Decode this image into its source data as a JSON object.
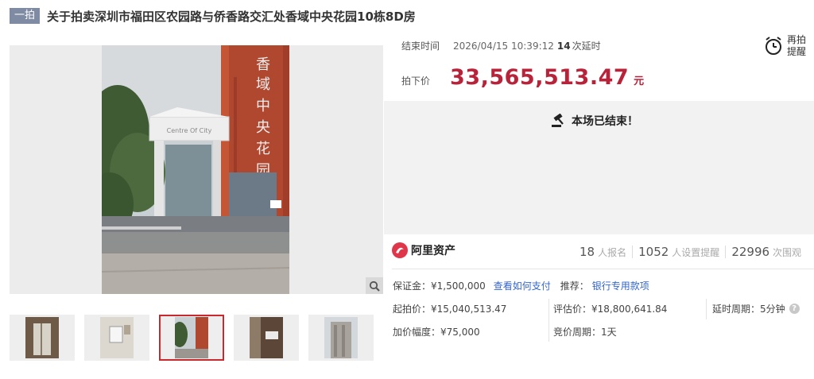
{
  "header": {
    "badge": "一拍",
    "title": "关于拍卖深圳市福田区农园路与侨香路交汇处香域中央花园10栋8D房"
  },
  "auction": {
    "end_time_label": "结束时间",
    "end_time": "2026/04/15 10:39:12",
    "extension_count": "14",
    "extension_label": "次延时",
    "remind_label": "再拍提醒",
    "price_label": "拍下价",
    "price": "33,565,513.47",
    "price_unit": "元",
    "ended_message": "本场已结束！"
  },
  "photo": {
    "building_text": "香域中央花园",
    "sign_text": "Centre Of City"
  },
  "stats": {
    "brand": "阿里资产",
    "registrations": "18",
    "registrations_label": "人报名",
    "reminders": "1052",
    "reminders_label": "人设置提醒",
    "views": "22996",
    "views_label": "次围观"
  },
  "details": {
    "deposit_label": "保证金：",
    "deposit": "¥1,500,000",
    "how_to_pay": "查看如何支付",
    "recommend_label": "推荐：",
    "bank_loan": "银行专用款项",
    "start_price_label": "起拍价：",
    "start_price": "¥15,040,513.47",
    "appraisal_label": "评估价：",
    "appraisal": "¥18,800,641.84",
    "delay_label": "延时周期：",
    "delay": "5分钟",
    "increment_label": "加价幅度：",
    "increment": "¥75,000",
    "bid_cycle_label": "竞价周期：",
    "bid_cycle": "1天"
  },
  "colors": {
    "price": "#b8233a",
    "link": "#3366cc",
    "badge": "#7f8aa3",
    "brand_red": "#e0364a",
    "active_thumb": "#c9282d"
  }
}
